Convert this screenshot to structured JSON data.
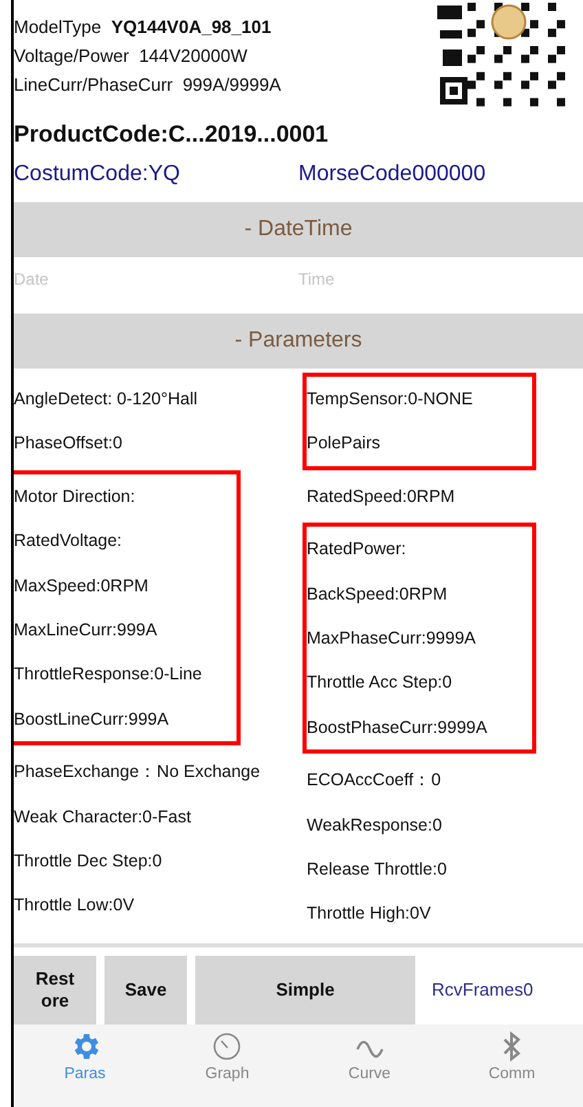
{
  "header": {
    "lines": [
      {
        "label": "ModelType",
        "value": "YQ144V0A_98_101",
        "bold_value": true
      },
      {
        "label": "Voltage/Power",
        "value": "144V20000W",
        "bold_value": false
      },
      {
        "label": "LineCurr/PhaseCurr",
        "value": "999A/9999A",
        "bold_value": false
      }
    ]
  },
  "product_code": "ProductCode:C...2019...0001",
  "codes": [
    "CostumCode:YQ",
    "MorseCode000000"
  ],
  "datetime": {
    "title": "- DateTime",
    "fields": [
      {
        "placeholder": "Date"
      },
      {
        "placeholder": "Time"
      }
    ]
  },
  "parameters": {
    "title": "- Parameters",
    "columns": [
      [
        {
          "highlighted": false,
          "items": [
            "AngleDetect: 0-120°Hall",
            "PhaseOffset:0"
          ]
        },
        {
          "highlighted": true,
          "items": [
            "Motor Direction:",
            "RatedVoltage:",
            "MaxSpeed:0RPM",
            "MaxLineCurr:999A",
            "ThrottleResponse:0-Line",
            "BoostLineCurr:999A"
          ]
        },
        {
          "highlighted": false,
          "items": [
            "PhaseExchange：No Exchange",
            "Weak Character:0-Fast",
            "Throttle Dec Step:0",
            "Throttle Low:0V"
          ]
        }
      ],
      [
        {
          "highlighted": true,
          "items": [
            "TempSensor:0-NONE",
            "PolePairs"
          ]
        },
        {
          "highlighted": false,
          "items": [
            "RatedSpeed:0RPM"
          ]
        },
        {
          "highlighted": true,
          "items": [
            "RatedPower:",
            "BackSpeed:0RPM",
            "MaxPhaseCurr:9999A",
            "Throttle Acc Step:0",
            "BoostPhaseCurr:9999A"
          ]
        },
        {
          "highlighted": false,
          "items": [
            "ECOAccCoeff：0",
            "WeakResponse:0",
            "Release Throttle:0",
            "Throttle High:0V"
          ]
        }
      ]
    ]
  },
  "actions": {
    "buttons": [
      "Rest\nore",
      "Save",
      "Simple"
    ],
    "rcv_frames": "RcvFrames0"
  },
  "tabs": [
    {
      "label": "Paras",
      "kind": "gear",
      "selected": true
    },
    {
      "label": "Graph",
      "kind": "gauge",
      "selected": false
    },
    {
      "label": "Curve",
      "kind": "wave",
      "selected": false
    },
    {
      "label": "Comm",
      "kind": "bluetooth",
      "selected": false
    }
  ]
}
